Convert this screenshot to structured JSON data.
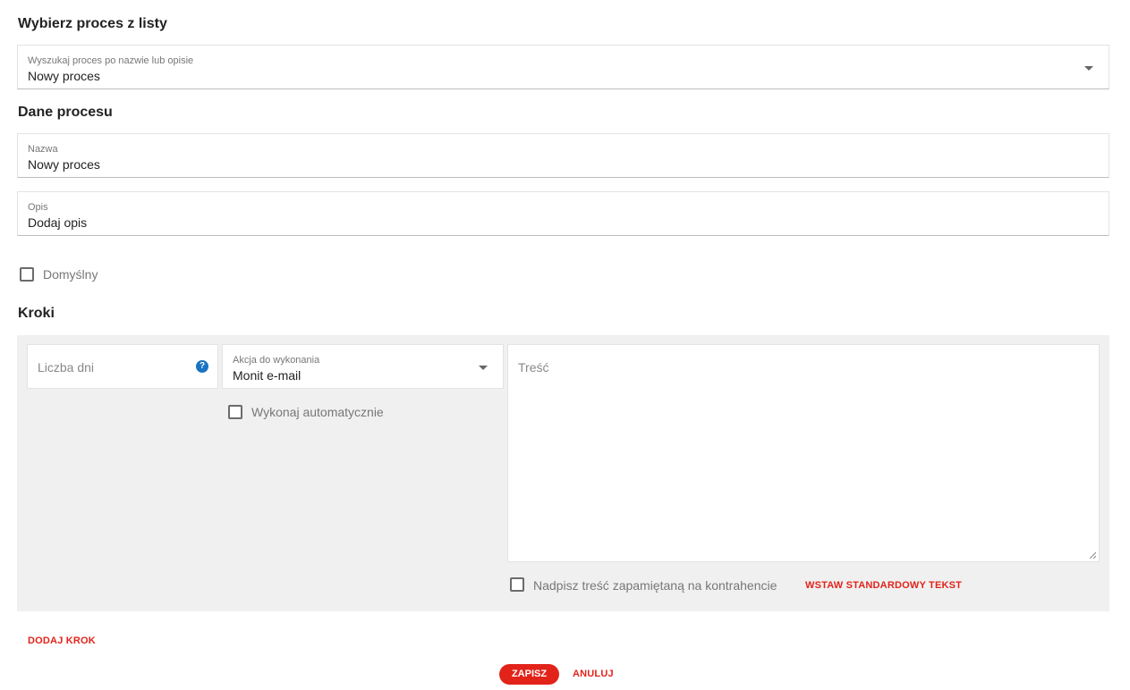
{
  "process_select": {
    "heading": "Wybierz proces z listy",
    "label": "Wyszukaj proces po nazwie lub opisie",
    "value": "Nowy proces"
  },
  "process_data": {
    "heading": "Dane procesu",
    "name_label": "Nazwa",
    "name_value": "Nowy proces",
    "description_label": "Opis",
    "description_value": "Dodaj opis",
    "default_checkbox_label": "Domyślny",
    "default_checked": false
  },
  "steps": {
    "heading": "Kroki",
    "days_placeholder": "Liczba dni",
    "help_icon": "question-circle-icon",
    "action_label": "Akcja do wykonania",
    "action_value": "Monit e-mail",
    "auto_checkbox_label": "Wykonaj automatycznie",
    "content_placeholder": "Treść",
    "overwrite_checkbox_label": "Nadpisz treść zapamiętaną na kontrahencie",
    "insert_standard_text": "WSTAW STANDARDOWY TEKST"
  },
  "actions": {
    "add_step": "DODAJ KROK",
    "save": "ZAPISZ",
    "cancel": "ANULUJ"
  },
  "colors": {
    "accent": "#e2231a",
    "help_icon": "#1a73c1",
    "panel_bg": "#f0f0f0"
  }
}
